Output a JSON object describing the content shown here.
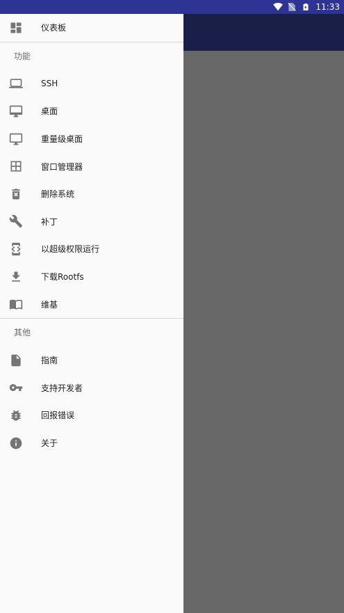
{
  "status_bar": {
    "time": "11:33"
  },
  "drawer": {
    "top_item": {
      "label": "仪表板",
      "icon": "dashboard-icon"
    },
    "sections": [
      {
        "title": "功能",
        "items": [
          {
            "label": "SSH",
            "icon": "monitor-icon"
          },
          {
            "label": "桌面",
            "icon": "desktop-icon"
          },
          {
            "label": "重量级桌面",
            "icon": "desktop-icon"
          },
          {
            "label": "窗口管理器",
            "icon": "window-grid-icon"
          },
          {
            "label": "删除系统",
            "icon": "trash-icon"
          },
          {
            "label": "补丁",
            "icon": "wrench-icon"
          },
          {
            "label": "以超级权限运行",
            "icon": "developer-mode-icon"
          },
          {
            "label": "下载Rootfs",
            "icon": "download-icon"
          },
          {
            "label": "维基",
            "icon": "book-icon"
          }
        ]
      },
      {
        "title": "其他",
        "items": [
          {
            "label": "指南",
            "icon": "document-icon"
          },
          {
            "label": "支持开发者",
            "icon": "key-icon"
          },
          {
            "label": "回报错误",
            "icon": "bug-icon"
          },
          {
            "label": "关于",
            "icon": "info-icon"
          }
        ]
      }
    ]
  },
  "colors": {
    "status_bar": "#2d3494",
    "app_bar": "#1a1f4a",
    "scrim": "#686868",
    "drawer_bg": "#fafafa",
    "icon": "#757575"
  }
}
